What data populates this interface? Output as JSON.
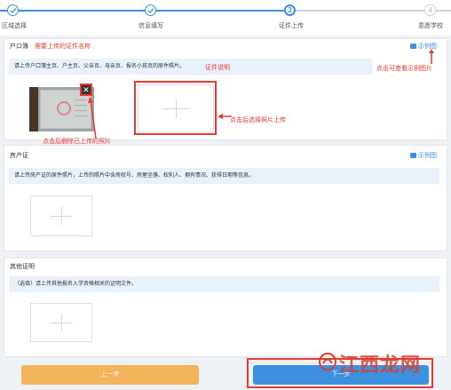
{
  "steps": {
    "items": [
      {
        "label": "区域选择"
      },
      {
        "label": "信息填写"
      },
      {
        "label": "证件上传",
        "number": "3"
      },
      {
        "label": "意愿学校",
        "number": "4"
      }
    ]
  },
  "hukou": {
    "title": "户口簿",
    "title_note": "需要上传的证件名称",
    "sample_label": "示例图",
    "sample_note": "点击可查看示例图片",
    "hint": "请上传户口簿主页、户主页、父亲页、母亲页、报名小孩页的原件照片。",
    "hint_note": "证件说明",
    "delete_glyph": "✕",
    "delete_note": "点击后删除已上传的照片",
    "upload_note": "点击后选择照片上传"
  },
  "property": {
    "title": "房产证",
    "sample_label": "示例图",
    "hint": "请上传房产证的原件照片，上传的照片中含房权号、房屋坐落、权利人、拥有情况、获得日期等信息。"
  },
  "other": {
    "title": "其他证明",
    "hint": "（选填）请上传其他报名入学资格相关的证明文件。"
  },
  "buttons": {
    "prev": "上一步",
    "next": "下一步"
  },
  "watermark": "江西龙网",
  "colors": {
    "accent": "#3d8fe0",
    "annotation": "#e83a2f",
    "prev_button": "#f2b35b",
    "next_button": "#3d8fe0"
  }
}
